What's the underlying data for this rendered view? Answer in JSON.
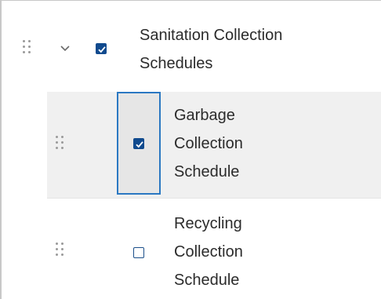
{
  "layer_list": {
    "group": {
      "title_line1": "Sanitation Collection",
      "title_line2": "Schedules",
      "expanded": true,
      "checked": true,
      "expander_icon": "chevron-down-icon",
      "drag_icon": "drag-handle-icon"
    },
    "layers": [
      {
        "line1": "Garbage",
        "line2": "Collection",
        "line3": "Schedule",
        "checked": true,
        "selected": true
      },
      {
        "line1": "Recycling",
        "line2": "Collection",
        "line3": "Schedule",
        "checked": false,
        "selected": false
      }
    ]
  },
  "colors": {
    "checkbox": "#104a8e",
    "focus": "#2b78c2",
    "selected_row": "#f0f0f0",
    "text": "#2b2b2b"
  }
}
